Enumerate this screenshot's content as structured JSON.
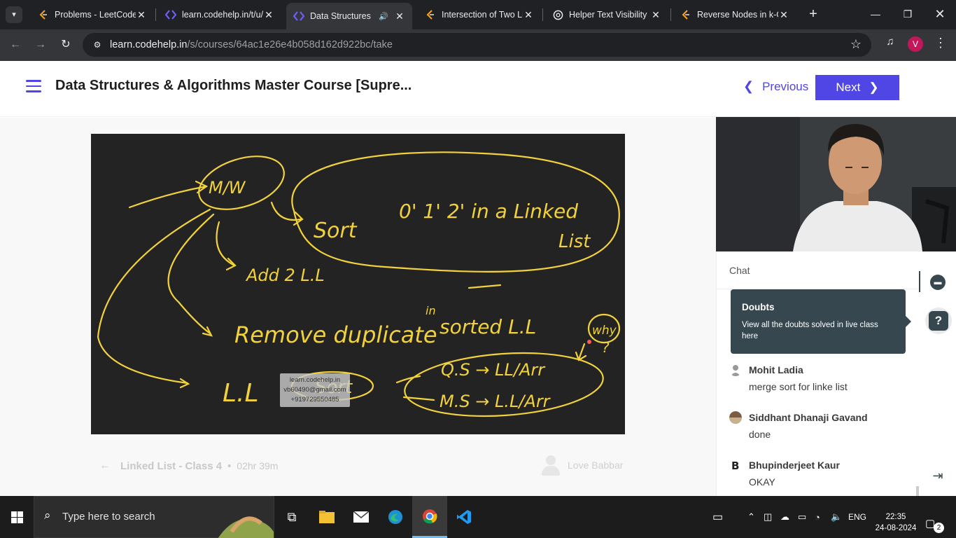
{
  "browser": {
    "tabs": [
      {
        "title": "Problems - LeetCode",
        "icon": "leetcode-icon",
        "active": false
      },
      {
        "title": "learn.codehelp.in/t/u/",
        "icon": "codehelp-icon",
        "active": false
      },
      {
        "title": "Data Structures &",
        "icon": "codehelp-icon",
        "active": true
      },
      {
        "title": "Intersection of Two Li",
        "icon": "leetcode-icon",
        "active": false
      },
      {
        "title": "Helper Text Visibility",
        "icon": "chatgpt-icon",
        "active": false
      },
      {
        "title": "Reverse Nodes in k-G",
        "icon": "leetcode-icon",
        "active": false
      }
    ],
    "url_host": "learn.codehelp.in",
    "url_path": "/s/courses/64ac1e26e4b058d162d922bc/take",
    "profile_initial": "V"
  },
  "header": {
    "course_title": "Data Structures & Algorithms Master Course [Supre...",
    "previous_label": "Previous",
    "next_label": "Next"
  },
  "video": {
    "watermark": [
      "learn.codehelp.in",
      "vb60490@gmail.com",
      "+919729550485"
    ],
    "whiteboard_text": [
      "M/W",
      "Sort 0' 1' 2' in a Linked List",
      "Add 2 L.L",
      "Remove duplicate in sorted L.L",
      "why ?",
      "L.L Sort",
      "Q.S → LL/Arr",
      "M.S → L.L/Arr"
    ]
  },
  "lecture": {
    "title": "Linked List - Class 4",
    "duration": "02hr 39m",
    "instructor": "Love Babbar"
  },
  "chat": {
    "heading": "Chat",
    "tooltip_title": "Doubts",
    "tooltip_text": "View all the doubts solved in live class here",
    "messages": [
      {
        "author": "Mohit Ladia",
        "text": "merge sort for linke list"
      },
      {
        "author": "Siddhant Dhanaji Gavand",
        "text": "done"
      },
      {
        "author": "Bhupinderjeet Kaur",
        "text": "OKAY"
      }
    ]
  },
  "taskbar": {
    "search_placeholder": "Type here to search",
    "language": "ENG",
    "time": "22:35",
    "date": "24-08-2024",
    "notification_count": "2"
  },
  "colors": {
    "accent": "#4f46e5",
    "whiteboard_ink": "#f2d23c",
    "tooltip_bg": "#37474f"
  }
}
